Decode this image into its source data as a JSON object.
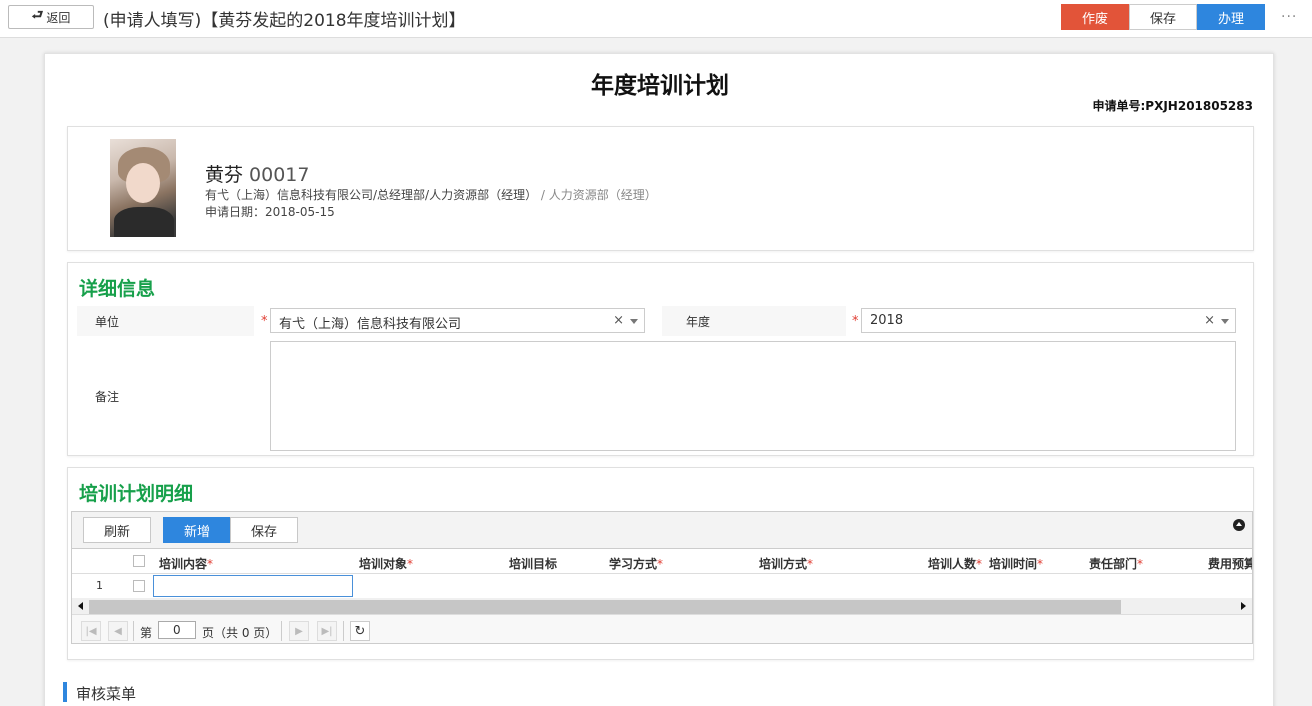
{
  "topbar": {
    "back_label": "返回",
    "title": "(申请人填写)【黄芬发起的2018年度培训计划】",
    "buttons": {
      "void": "作废",
      "save": "保存",
      "handle": "办理"
    },
    "more": "···"
  },
  "doc": {
    "title": "年度培训计划",
    "apply_no": "申请单号:PXJH201805283"
  },
  "profile": {
    "name": "黄芬",
    "code": "00017",
    "dept_main": "有弋（上海）信息科技有限公司/总经理部/人力资源部（经理）",
    "dept_secondary": "/ 人力资源部（经理）",
    "apply_date": "申请日期：2018-05-15"
  },
  "details": {
    "title": "详细信息",
    "unit_label": "单位",
    "unit_value": "有弋（上海）信息科技有限公司",
    "year_label": "年度",
    "year_value": "2018",
    "remark_label": "备注",
    "required_mark": "*",
    "clear_symbol": "×"
  },
  "plan": {
    "title": "培训计划明细",
    "toolbar": {
      "refresh": "刷新",
      "add": "新增",
      "save": "保存"
    },
    "columns": [
      "培训内容",
      "培训对象",
      "培训目标",
      "学习方式",
      "培训方式",
      "培训人数",
      "培训时间",
      "责任部门",
      "费用预算"
    ],
    "required_star": "*",
    "rows": [
      {
        "num": "1"
      }
    ],
    "pager": {
      "page_prefix": "第",
      "page_value": "0",
      "page_suffix": "页（共 0 页）"
    }
  },
  "audit": {
    "title": "审核菜单"
  },
  "colors": {
    "accent_green": "#17a04b",
    "red": "#e25439",
    "blue": "#2e86de"
  }
}
